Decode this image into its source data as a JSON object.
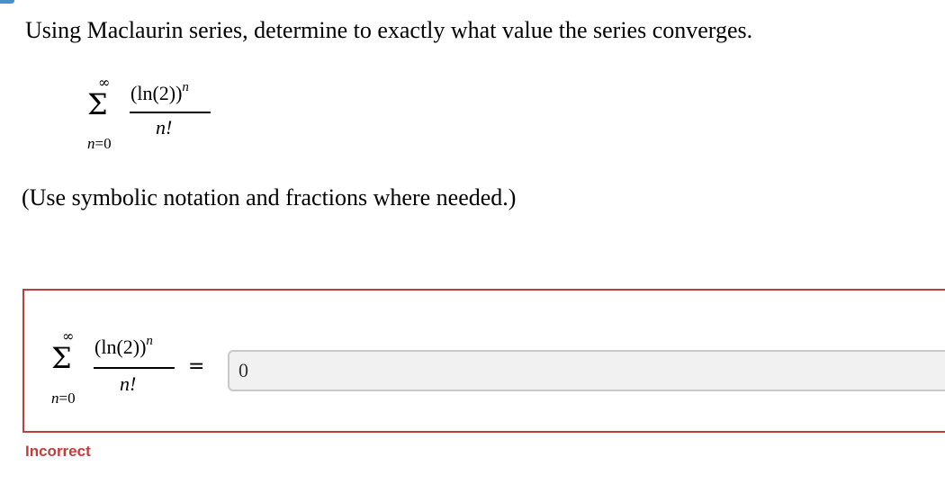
{
  "question": {
    "prompt": "Using Maclaurin series, determine to exactly what value the series converges.",
    "series": {
      "upper": "∞",
      "sigma": "Σ",
      "lower": "n=0",
      "numerator_base": "(ln(2))",
      "numerator_exp": "n",
      "denominator": "n!"
    },
    "note": "(Use symbolic notation and fractions where needed.)"
  },
  "answer": {
    "series": {
      "upper": "∞",
      "sigma": "Σ",
      "lower": "n=0",
      "numerator_base": "(ln(2))",
      "numerator_exp": "n",
      "denominator": "n!"
    },
    "equals": "=",
    "value": "0",
    "feedback": "Incorrect"
  },
  "colors": {
    "error": "#c33c3c",
    "input_bg": "#f1f1f1",
    "accent": "#4a90c8"
  }
}
